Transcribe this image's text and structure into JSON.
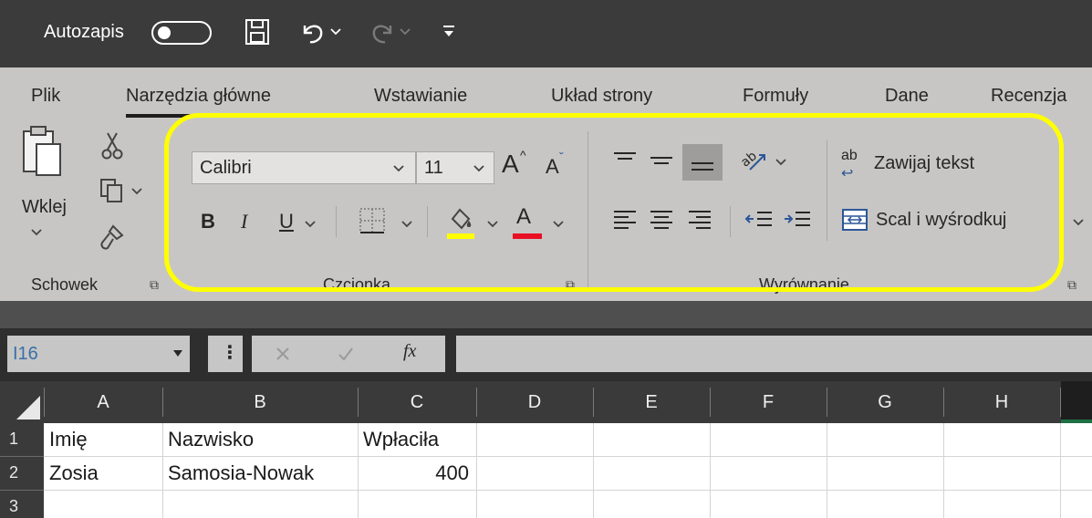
{
  "quick_access": {
    "autosave_label": "Autozapis",
    "autosave_state": "off",
    "icons": [
      "save-icon",
      "undo-icon",
      "redo-icon",
      "customize-icon"
    ]
  },
  "tabs": [
    {
      "label": "Plik",
      "active": false
    },
    {
      "label": "Narzędzia główne",
      "active": true
    },
    {
      "label": "Wstawianie",
      "active": false
    },
    {
      "label": "Układ strony",
      "active": false
    },
    {
      "label": "Formuły",
      "active": false
    },
    {
      "label": "Dane",
      "active": false
    },
    {
      "label": "Recenzja",
      "active": false
    }
  ],
  "ribbon": {
    "clipboard": {
      "paste_label": "Wklej",
      "group_label": "Schowek"
    },
    "font": {
      "font_name": "Calibri",
      "font_size": "11",
      "bold": "B",
      "italic": "I",
      "underline": "U",
      "font_color_letter": "A",
      "grow_letter": "A",
      "shrink_letter": "A",
      "group_label": "Czcionka",
      "fill_color": "#ffff00",
      "font_color": "#e81123"
    },
    "alignment": {
      "wrap_text_label": "Zawijaj tekst",
      "wrap_icon_text": "ab",
      "merge_label": "Scal i wyśrodkuj",
      "group_label": "Wyrównanie"
    },
    "highlight_color": "#ffff00"
  },
  "formula_bar": {
    "name_box": "I16",
    "formula": ""
  },
  "sheet": {
    "columns": [
      "A",
      "B",
      "C",
      "D",
      "E",
      "F",
      "G",
      "H"
    ],
    "rows": [
      {
        "num": "1",
        "cells": [
          "Imię",
          "Nazwisko",
          "Wpłaciła",
          "",
          "",
          "",
          "",
          ""
        ]
      },
      {
        "num": "2",
        "cells": [
          "Zosia",
          "Samosia-Nowak",
          "400",
          "",
          "",
          "",
          "",
          ""
        ]
      },
      {
        "num": "3",
        "cells": [
          "",
          "",
          "",
          "",
          "",
          "",
          "",
          ""
        ]
      }
    ]
  }
}
